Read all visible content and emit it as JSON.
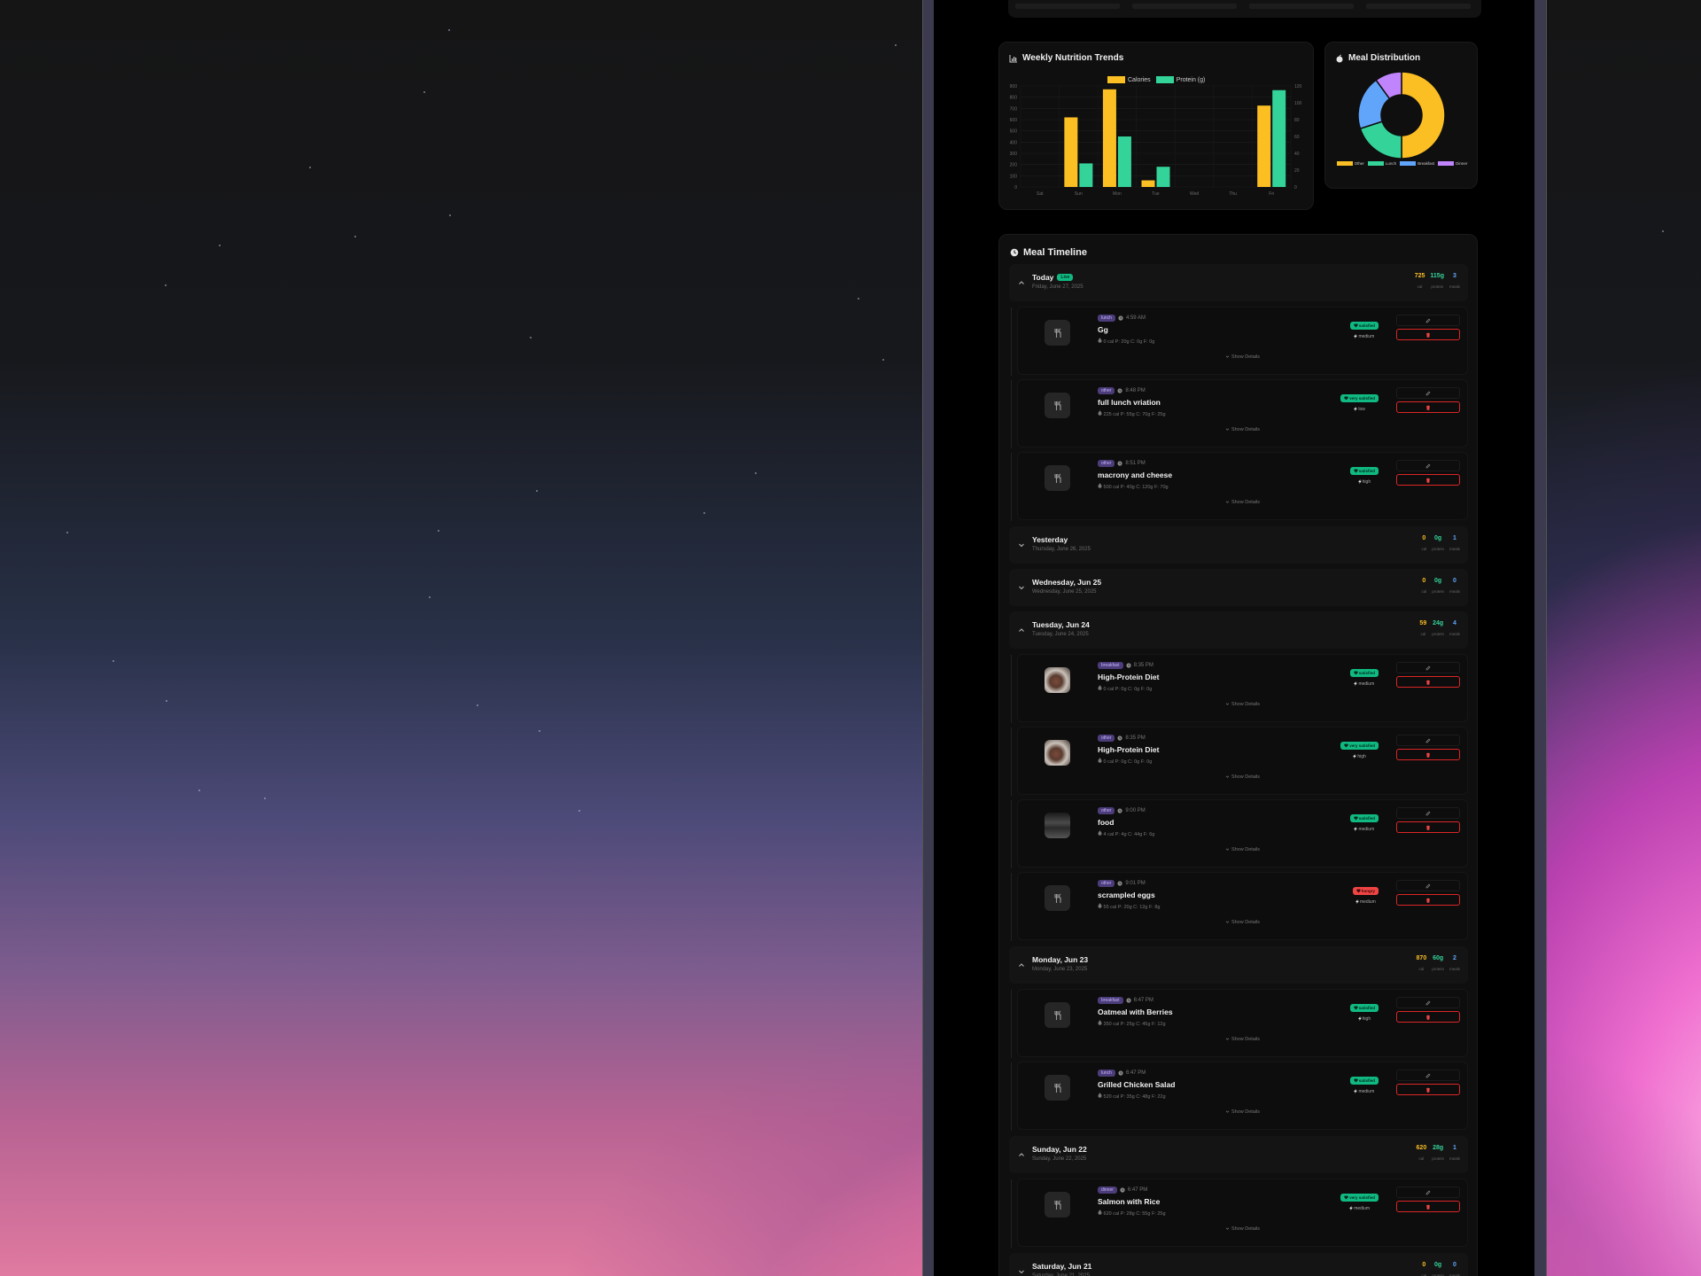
{
  "charts": {
    "trends_title": "Weekly Nutrition Trends",
    "distribution_title": "Meal Distribution"
  },
  "chart_data": [
    {
      "type": "bar",
      "title": "Weekly Nutrition Trends",
      "categories": [
        "Sat",
        "Sun",
        "Mon",
        "Tue",
        "Wed",
        "Thu",
        "Fri"
      ],
      "series": [
        {
          "name": "Calories",
          "axis": "left",
          "color": "#fbbf24",
          "values": [
            0,
            620,
            870,
            59,
            0,
            0,
            725
          ]
        },
        {
          "name": "Protein (g)",
          "axis": "right",
          "color": "#34d399",
          "values": [
            0,
            28,
            60,
            24,
            0,
            0,
            115
          ]
        }
      ],
      "ylim_left": [
        0,
        900
      ],
      "yticks_left": [
        "900",
        "800",
        "700",
        "600",
        "500",
        "400",
        "300",
        "200",
        "100",
        "0"
      ],
      "ylim_right": [
        0,
        120
      ],
      "yticks_right": [
        "120",
        "100",
        "80",
        "60",
        "40",
        "20",
        "0"
      ],
      "grid": true,
      "legend": "top-center"
    },
    {
      "type": "pie",
      "title": "Meal Distribution",
      "style": "doughnut",
      "categories": [
        "Other",
        "Lunch",
        "Breakfast",
        "Dinner"
      ],
      "values": [
        5,
        2,
        2,
        1
      ],
      "colors": [
        "#fbbf24",
        "#34d399",
        "#60a5fa",
        "#c084fc"
      ],
      "legend": "bottom"
    }
  ],
  "timeline": {
    "title": "Meal Timeline",
    "live_badge": "Live",
    "stat_labels": {
      "cal": "cal",
      "protein": "protein",
      "meals": "meals"
    },
    "show_details": "Show Details",
    "days": [
      {
        "title": "Today",
        "live": true,
        "subtitle": "Friday, June 27, 2025",
        "expanded": true,
        "cal": "725",
        "protein": "115g",
        "meals": "3",
        "items": [
          {
            "tag": "lunch",
            "time": "4:59 AM",
            "name": "Gg",
            "macros": "0 cal  P: 20g  C: 0g  F: 0g",
            "status": "satisfied",
            "status_color": "green",
            "energy": "medium",
            "thumb": "icon"
          },
          {
            "tag": "other",
            "time": "8:48 PM",
            "name": "full lunch vriation",
            "macros": "225 cal  P: 55g  C: 70g  F: 25g",
            "status": "very satisfied",
            "status_color": "green",
            "energy": "low",
            "thumb": "icon"
          },
          {
            "tag": "other",
            "time": "8:51 PM",
            "name": "macrony and cheese",
            "macros": "500 cal  P: 40g  C: 120g  F: 70g",
            "status": "satisfied",
            "status_color": "green",
            "energy": "high",
            "thumb": "icon"
          }
        ]
      },
      {
        "title": "Yesterday",
        "subtitle": "Thursday, June 26, 2025",
        "expanded": false,
        "cal": "0",
        "protein": "0g",
        "meals": "1",
        "items": []
      },
      {
        "title": "Wednesday, Jun 25",
        "subtitle": "Wednesday, June 25, 2025",
        "expanded": false,
        "cal": "0",
        "protein": "0g",
        "meals": "0",
        "items": []
      },
      {
        "title": "Tuesday, Jun 24",
        "subtitle": "Tuesday, June 24, 2025",
        "expanded": true,
        "cal": "59",
        "protein": "24g",
        "meals": "4",
        "items": [
          {
            "tag": "breakfast",
            "time": "8:35 PM",
            "name": "High-Protein Diet",
            "macros": "0 cal  P: 0g  C: 0g  F: 0g",
            "status": "satisfied",
            "status_color": "green",
            "energy": "medium",
            "thumb": "photo"
          },
          {
            "tag": "other",
            "time": "8:35 PM",
            "name": "High-Protein Diet",
            "macros": "0 cal  P: 0g  C: 0g  F: 0g",
            "status": "very satisfied",
            "status_color": "green",
            "energy": "high",
            "thumb": "photo"
          },
          {
            "tag": "other",
            "time": "9:00 PM",
            "name": "food",
            "macros": "4 cal  P: 4g  C: 44g  F: 6g",
            "status": "satisfied",
            "status_color": "green",
            "energy": "medium",
            "thumb": "photo2"
          },
          {
            "tag": "other",
            "time": "9:01 PM",
            "name": "scrampled eggs",
            "macros": "55 cal  P: 20g  C: 12g  F: 8g",
            "status": "hungry",
            "status_color": "red",
            "energy": "medium",
            "thumb": "icon"
          }
        ]
      },
      {
        "title": "Monday, Jun 23",
        "subtitle": "Monday, June 23, 2025",
        "expanded": true,
        "cal": "870",
        "protein": "60g",
        "meals": "2",
        "items": [
          {
            "tag": "breakfast",
            "time": "6:47 PM",
            "name": "Oatmeal with Berries",
            "macros": "350 cal  P: 25g  C: 45g  F: 12g",
            "status": "satisfied",
            "status_color": "green",
            "energy": "high",
            "thumb": "icon"
          },
          {
            "tag": "lunch",
            "time": "6:47 PM",
            "name": "Grilled Chicken Salad",
            "macros": "520 cal  P: 35g  C: 48g  F: 22g",
            "status": "satisfied",
            "status_color": "green",
            "energy": "medium",
            "thumb": "icon"
          }
        ]
      },
      {
        "title": "Sunday, Jun 22",
        "subtitle": "Sunday, June 22, 2025",
        "expanded": true,
        "cal": "620",
        "protein": "28g",
        "meals": "1",
        "items": [
          {
            "tag": "dinner",
            "time": "6:47 PM",
            "name": "Salmon with Rice",
            "macros": "620 cal  P: 28g  C: 55g  F: 25g",
            "status": "very satisfied",
            "status_color": "green",
            "energy": "medium",
            "thumb": "icon"
          }
        ]
      },
      {
        "title": "Saturday, Jun 21",
        "subtitle": "Saturday, June 21, 2025",
        "expanded": false,
        "cal": "0",
        "protein": "0g",
        "meals": "0",
        "items": []
      }
    ]
  }
}
